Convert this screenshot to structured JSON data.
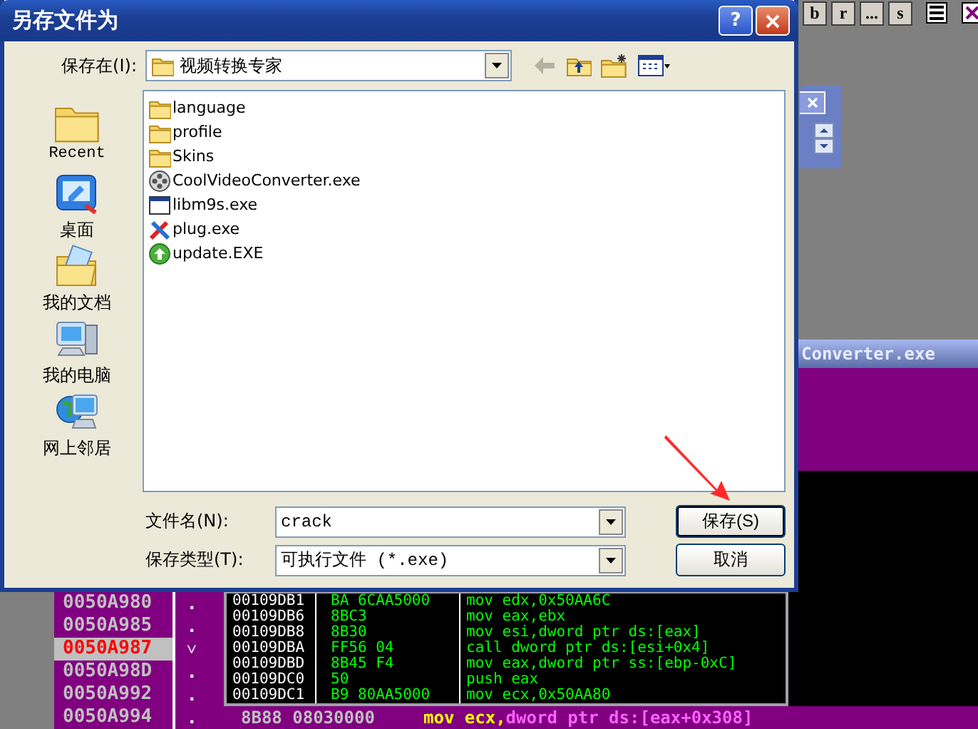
{
  "dialog": {
    "title": "另存文件为",
    "help_button": "?",
    "save_in_label": "保存在(I):",
    "save_in_value": "视频转换专家",
    "places": [
      {
        "label": "Recent",
        "kind": "recent"
      },
      {
        "label": "桌面",
        "kind": "desktop"
      },
      {
        "label": "我的文档",
        "kind": "documents"
      },
      {
        "label": "我的电脑",
        "kind": "computer"
      },
      {
        "label": "网上邻居",
        "kind": "network"
      }
    ],
    "files": [
      {
        "name": "language",
        "kind": "folder"
      },
      {
        "name": "profile",
        "kind": "folder"
      },
      {
        "name": "Skins",
        "kind": "folder"
      },
      {
        "name": "CoolVideoConverter.exe",
        "kind": "reel"
      },
      {
        "name": "libm9s.exe",
        "kind": "window"
      },
      {
        "name": "plug.exe",
        "kind": "tools"
      },
      {
        "name": "update.EXE",
        "kind": "update"
      }
    ],
    "filename_label": "文件名(N):",
    "filename_value": "crack",
    "filetype_label": "保存类型(T):",
    "filetype_value": "可执行文件 (*.exe)",
    "buttons": [
      "保存(S)",
      "取消"
    ]
  },
  "debugger": {
    "toolbar": [
      "b",
      "r",
      "...",
      "s"
    ],
    "window_title": "Converter.exe",
    "address_rows": [
      {
        "address": "0050A980",
        "mark": ".",
        "selected": false
      },
      {
        "address": "0050A985",
        "mark": ".",
        "selected": false
      },
      {
        "address": "0050A987",
        "mark": "˅",
        "selected": true
      },
      {
        "address": "0050A98D",
        "mark": ".",
        "selected": false
      },
      {
        "address": "0050A992",
        "mark": ".",
        "selected": false
      },
      {
        "address": "0050A994",
        "mark": ".",
        "selected": false
      }
    ],
    "bottom_row": {
      "bytes": "8B88 08030000",
      "mnemonic": "mov ecx,",
      "operand": "dword ptr ds:[eax+0x308]"
    },
    "popup_rows": [
      {
        "address": "00109DB1",
        "bytes": "BA 6CAA5000",
        "instruction": "mov edx,0x50AA6C"
      },
      {
        "address": "00109DB6",
        "bytes": "8BC3",
        "instruction": "mov eax,ebx"
      },
      {
        "address": "00109DB8",
        "bytes": "8B30",
        "instruction": "mov esi,dword ptr ds:[eax]"
      },
      {
        "address": "00109DBA",
        "bytes": "FF56 04",
        "instruction": "call dword ptr ds:[esi+0x4]"
      },
      {
        "address": "00109DBD",
        "bytes": "8B45 F4",
        "instruction": "mov eax,dword ptr ss:[ebp-0xC]"
      },
      {
        "address": "00109DC0",
        "bytes": "50",
        "instruction": "push eax"
      },
      {
        "address": "00109DC1",
        "bytes": "B9 80AA5000",
        "instruction": "mov ecx,0x50AA80"
      }
    ]
  }
}
